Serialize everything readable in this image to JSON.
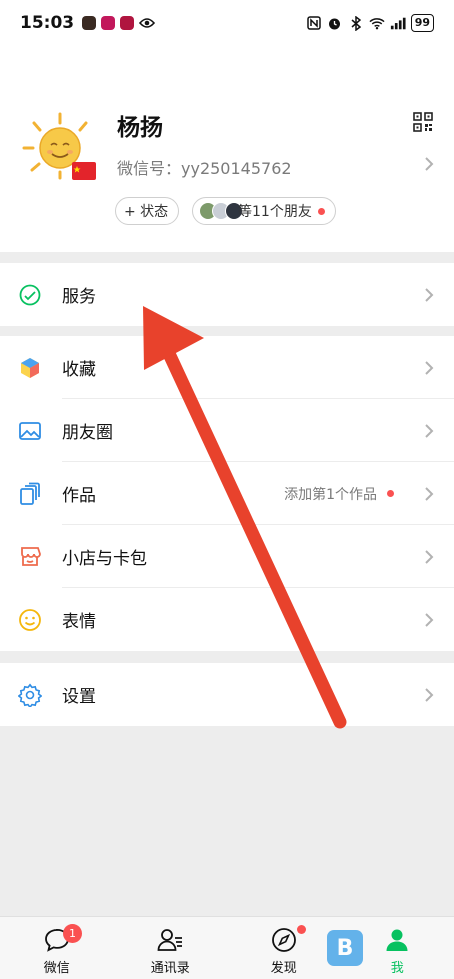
{
  "status_bar": {
    "time": "15:03",
    "battery": "99"
  },
  "profile": {
    "name": "杨扬",
    "wechat_id": "微信号：yy250145762",
    "status_button": "+ 状态",
    "friends_chip": "等11个朋友"
  },
  "menu": {
    "service": "服务",
    "favorites": "收藏",
    "moments": "朋友圈",
    "works": "作品",
    "works_hint": "添加第1个作品",
    "store_wallet": "小店与卡包",
    "stickers": "表情",
    "settings": "设置"
  },
  "tabbar": {
    "chats": "微信",
    "chats_badge": "1",
    "contacts": "通讯录",
    "discover": "发现",
    "me": "我"
  },
  "colors": {
    "accent": "#07c160",
    "badge": "#fa5151",
    "annotation_arrow": "#e8422c"
  }
}
